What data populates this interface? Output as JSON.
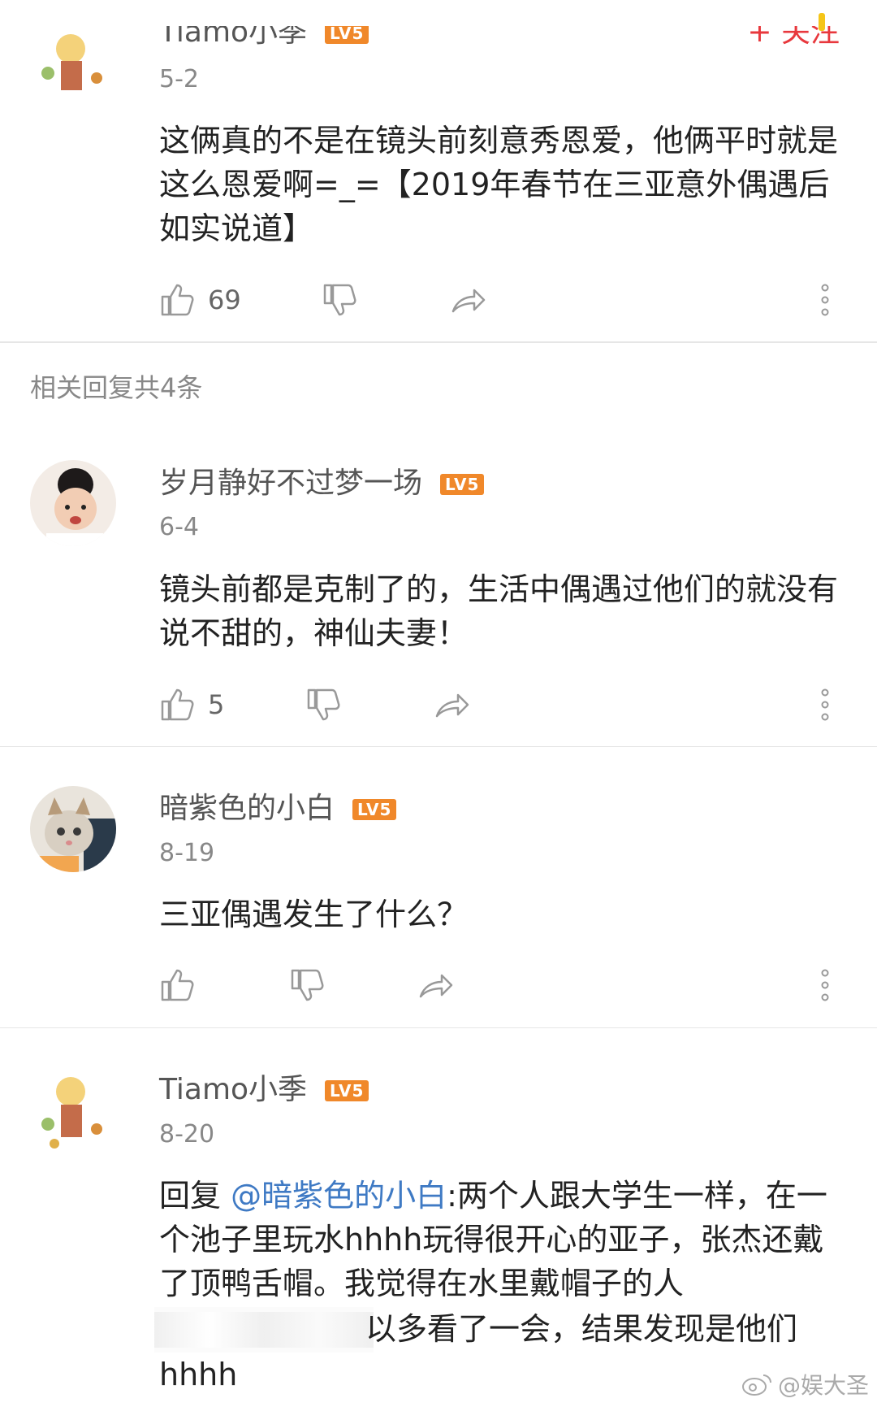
{
  "top_comment": {
    "username_partial": "Tiamo小季",
    "follow_label": "+ 关注",
    "date": "5-2",
    "text": "这俩真的不是在镜头前刻意秀恩爱，他俩平时就是这么恩爱啊=_=【2019年春节在三亚意外偶遇后如实说道】",
    "likes": "69",
    "level": "LV5"
  },
  "related_label": "相关回复共4条",
  "replies": [
    {
      "username": "岁月静好不过梦一场",
      "level": "LV5",
      "date": "6-4",
      "text": "镜头前都是克制了的，生活中偶遇过他们的就没有说不甜的，神仙夫妻！",
      "likes": "5"
    },
    {
      "username": "暗紫色的小白",
      "level": "LV5",
      "date": "8-19",
      "text": "三亚偶遇发生了什么？",
      "likes": ""
    },
    {
      "username": "Tiamo小季",
      "level": "LV5",
      "date": "8-20",
      "reply_prefix": "回复",
      "mention": "@暗紫色的小白",
      "text": ":两个人跟大学生一样，在一个池子里玩水hhhh玩得很开心的亚子，张杰还戴了顶鸭舌帽。我觉得在水里戴帽子的人",
      "text_tail": "以多看了一会，结果发现是他们",
      "text_last": "hhhh"
    }
  ],
  "watermark": "@娱大圣",
  "colors": {
    "level_badge": "#f0882a",
    "mention": "#3f7ac4",
    "follow": "#e8383d"
  }
}
